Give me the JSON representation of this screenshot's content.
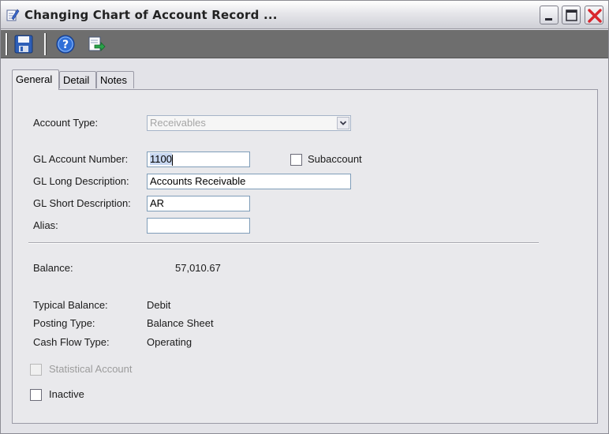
{
  "window": {
    "title": "Changing Chart of Account Record ..."
  },
  "toolbar": {
    "buttons": [
      {
        "name": "save",
        "icon": "save-icon"
      },
      {
        "name": "help",
        "icon": "help-icon"
      },
      {
        "name": "export",
        "icon": "export-icon"
      }
    ]
  },
  "tabs": [
    {
      "label": "General",
      "active": true
    },
    {
      "label": "Detail",
      "active": false
    },
    {
      "label": "Notes",
      "active": false
    }
  ],
  "form": {
    "account_type_label": "Account Type:",
    "account_type_value": "Receivables",
    "gl_account_number_label": "GL Account Number:",
    "gl_account_number_value": "1100",
    "subaccount_label": "Subaccount",
    "gl_long_desc_label": "GL Long Description:",
    "gl_long_desc_value": "Accounts Receivable",
    "gl_short_desc_label": "GL Short Description:",
    "gl_short_desc_value": "AR",
    "alias_label": "Alias:",
    "alias_value": "",
    "balance_label": "Balance:",
    "balance_value": "57,010.67",
    "typical_balance_label": "Typical Balance:",
    "typical_balance_value": "Debit",
    "posting_type_label": "Posting Type:",
    "posting_type_value": "Balance Sheet",
    "cash_flow_type_label": "Cash Flow Type:",
    "cash_flow_type_value": "Operating",
    "statistical_account_label": "Statistical Account",
    "inactive_label": "Inactive"
  },
  "colors": {
    "toolbar_bg": "#6e6e6e",
    "close_x": "#d9262d",
    "field_border": "#7f9db9"
  }
}
